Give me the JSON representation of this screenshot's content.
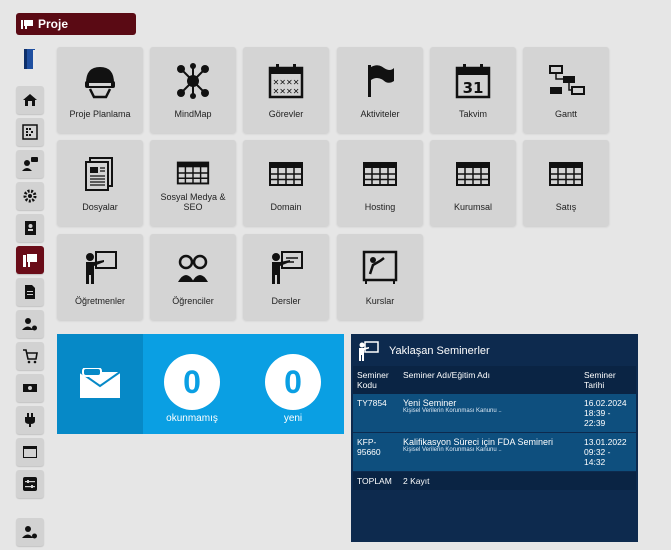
{
  "app": {
    "title": "Proje"
  },
  "tiles": [
    {
      "label": "Proje Planlama",
      "icon": "helmet-icon"
    },
    {
      "label": "MindMap",
      "icon": "mindmap-icon"
    },
    {
      "label": "Görevler",
      "icon": "calendar-tasks-icon"
    },
    {
      "label": "Aktiviteler",
      "icon": "flag-icon"
    },
    {
      "label": "Takvim",
      "icon": "calendar-31-icon"
    },
    {
      "label": "Gantt",
      "icon": "gantt-icon"
    },
    {
      "label": "Dosyalar",
      "icon": "documents-icon"
    },
    {
      "label": "Sosyal Medya & SEO",
      "icon": "grid-table-icon"
    },
    {
      "label": "Domain",
      "icon": "grid-table-icon"
    },
    {
      "label": "Hosting",
      "icon": "grid-table-icon"
    },
    {
      "label": "Kurumsal",
      "icon": "grid-table-icon"
    },
    {
      "label": "Satış",
      "icon": "grid-table-icon"
    },
    {
      "label": "Öğretmenler",
      "icon": "teacher-icon"
    },
    {
      "label": "Öğrenciler",
      "icon": "students-icon"
    },
    {
      "label": "Dersler",
      "icon": "lesson-icon"
    },
    {
      "label": "Kurslar",
      "icon": "course-icon"
    }
  ],
  "stats": {
    "unread_count": "0",
    "unread_label": "okunmamış",
    "new_count": "0",
    "new_label": "yeni"
  },
  "seminars": {
    "title": "Yaklaşan Seminerler",
    "columns": [
      "Seminer Kodu",
      "Seminer Adı/Eğitim Adı",
      "Seminer Tarihi"
    ],
    "rows": [
      {
        "code": "TY7854",
        "name": "Yeni Seminer",
        "sub": "Kişisel Verilerin Korunması Kanunu ..",
        "date": "16.02.2024",
        "time": "18:39 - 22:39"
      },
      {
        "code": "KFP-95660",
        "name": "Kalifikasyon Süreci için FDA Semineri",
        "sub": "Kişisel Verilerin Korunması Kanunu ..",
        "date": "13.01.2022",
        "time": "09:32 - 14:32"
      }
    ],
    "total_label": "TOPLAM",
    "total_value": "2 Kayıt"
  },
  "colors": {
    "accent": "#6a0c18",
    "tile": "#d4d4d4",
    "stats": "#0a9fe3",
    "panel": "#0d2a4e"
  }
}
